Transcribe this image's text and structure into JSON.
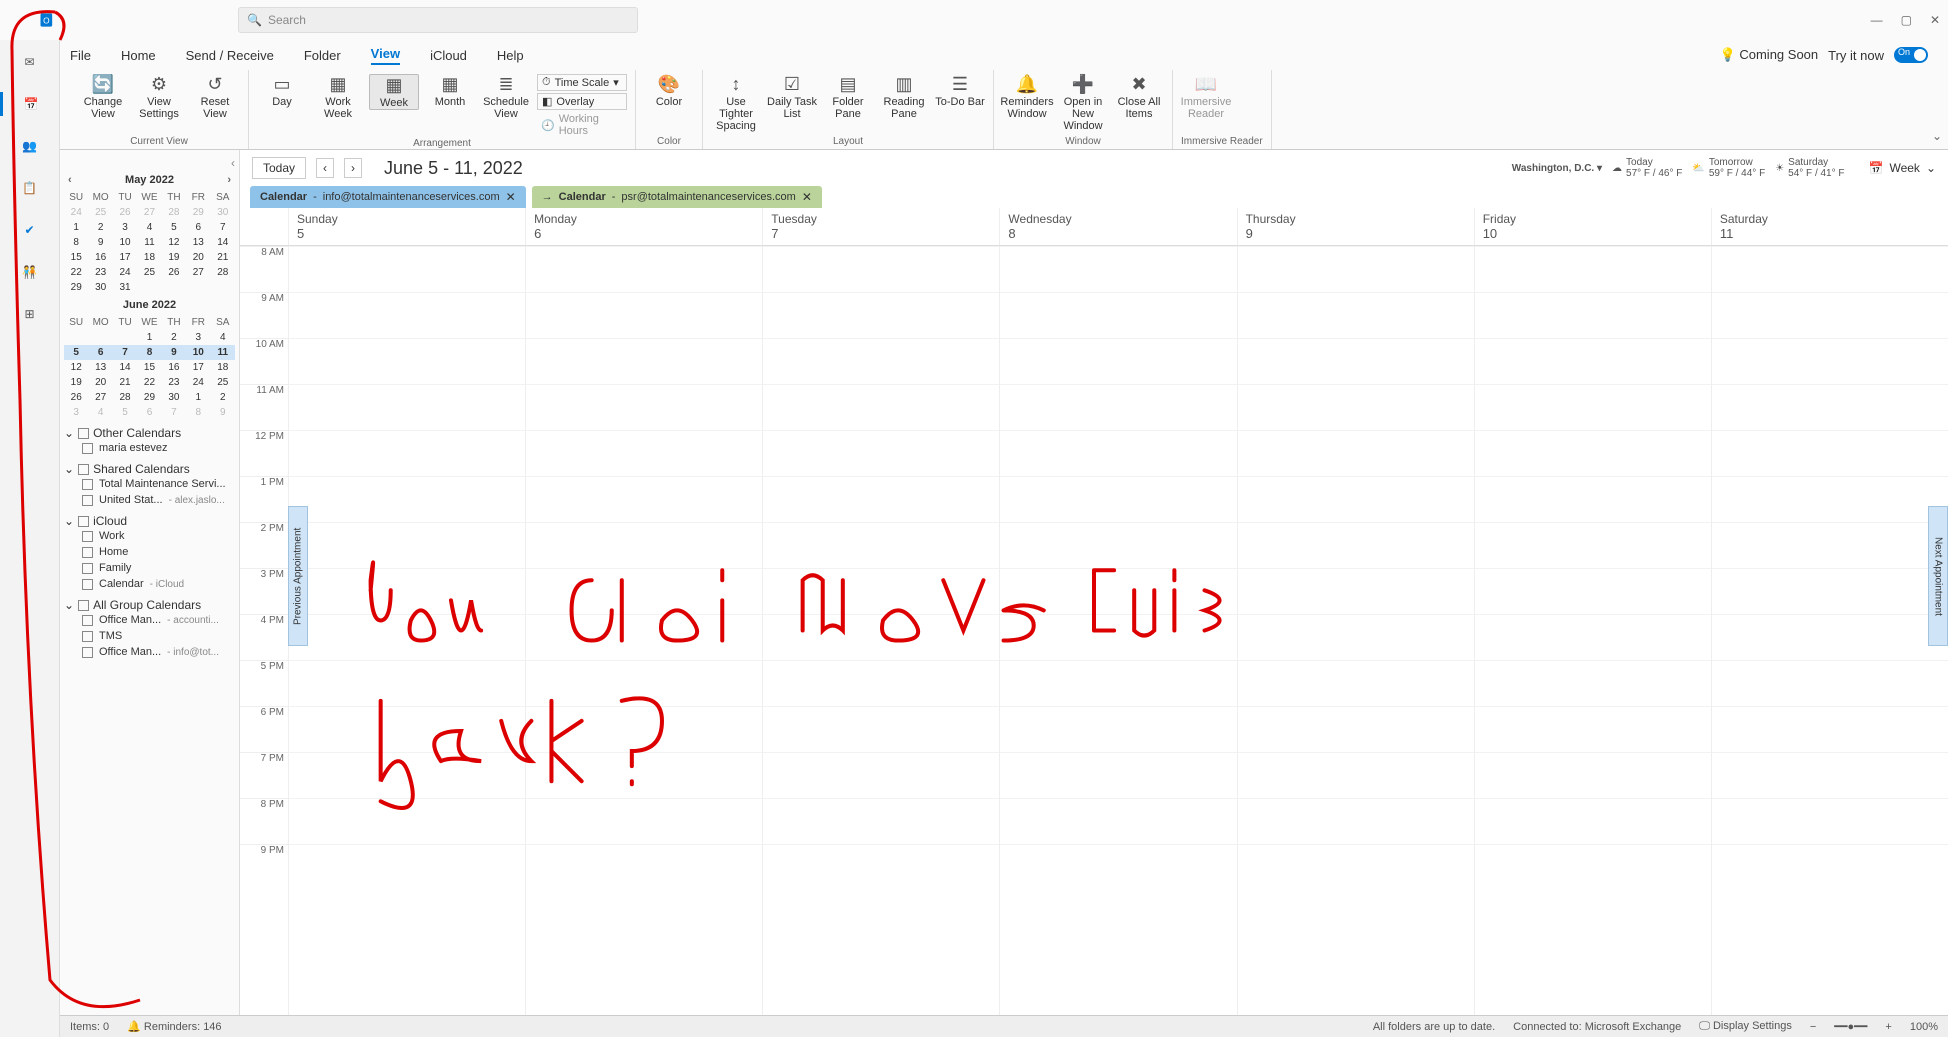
{
  "titlebar": {
    "search_placeholder": "Search"
  },
  "menutabs": {
    "items": [
      "File",
      "Home",
      "Send / Receive",
      "Folder",
      "View",
      "iCloud",
      "Help"
    ],
    "coming_soon": "Coming Soon",
    "try_it": "Try it now",
    "toggle": "On"
  },
  "ribbon": {
    "groups": {
      "current_view": {
        "label": "Current View",
        "btns": [
          {
            "label": "Change View"
          },
          {
            "label": "View Settings"
          },
          {
            "label": "Reset View"
          }
        ]
      },
      "arrangement": {
        "label": "Arrangement",
        "btns": [
          {
            "label": "Day"
          },
          {
            "label": "Work Week"
          },
          {
            "label": "Week",
            "sel": true
          },
          {
            "label": "Month"
          },
          {
            "label": "Schedule View"
          }
        ],
        "side": [
          {
            "label": "Time Scale"
          },
          {
            "label": "Overlay"
          },
          {
            "label": "Working Hours",
            "dim": true
          }
        ]
      },
      "color": {
        "label": "Color",
        "btn": "Color"
      },
      "layout": {
        "label": "Layout",
        "btns": [
          {
            "label": "Use Tighter Spacing"
          },
          {
            "label": "Daily Task List"
          },
          {
            "label": "Folder Pane"
          },
          {
            "label": "Reading Pane"
          },
          {
            "label": "To-Do Bar"
          }
        ]
      },
      "window": {
        "label": "Window",
        "btns": [
          {
            "label": "Reminders Window"
          },
          {
            "label": "Open in New Window"
          },
          {
            "label": "Close All Items"
          }
        ]
      },
      "immersive": {
        "label": "Immersive Reader",
        "btn": "Immersive Reader"
      }
    }
  },
  "mini_cal": {
    "may": {
      "title": "May 2022",
      "dows": [
        "SU",
        "MO",
        "TU",
        "WE",
        "TH",
        "FR",
        "SA"
      ],
      "rows": [
        [
          "24",
          "25",
          "26",
          "27",
          "28",
          "29",
          "30"
        ],
        [
          "1",
          "2",
          "3",
          "4",
          "5",
          "6",
          "7"
        ],
        [
          "8",
          "9",
          "10",
          "11",
          "12",
          "13",
          "14"
        ],
        [
          "15",
          "16",
          "17",
          "18",
          "19",
          "20",
          "21"
        ],
        [
          "22",
          "23",
          "24",
          "25",
          "26",
          "27",
          "28"
        ],
        [
          "29",
          "30",
          "31",
          "",
          "",
          "",
          ""
        ]
      ],
      "dim_row0": true
    },
    "june": {
      "title": "June 2022",
      "dows": [
        "SU",
        "MO",
        "TU",
        "WE",
        "TH",
        "FR",
        "SA"
      ],
      "rows": [
        [
          "",
          "",
          "",
          "1",
          "2",
          "3",
          "4"
        ],
        [
          "5",
          "6",
          "7",
          "8",
          "9",
          "10",
          "11"
        ],
        [
          "12",
          "13",
          "14",
          "15",
          "16",
          "17",
          "18"
        ],
        [
          "19",
          "20",
          "21",
          "22",
          "23",
          "24",
          "25"
        ],
        [
          "26",
          "27",
          "28",
          "29",
          "30",
          "1",
          "2"
        ],
        [
          "3",
          "4",
          "5",
          "6",
          "7",
          "8",
          "9"
        ]
      ],
      "hl_row": 1,
      "dim_row5": true
    }
  },
  "cal_groups": [
    {
      "name": "Other Calendars",
      "items": [
        {
          "label": "maria estevez"
        }
      ]
    },
    {
      "name": "Shared Calendars",
      "items": [
        {
          "label": "Total Maintenance Servi..."
        },
        {
          "label": "United Stat...",
          "src": "- alex.jaslo..."
        }
      ]
    },
    {
      "name": "iCloud",
      "items": [
        {
          "label": "Work"
        },
        {
          "label": "Home"
        },
        {
          "label": "Family"
        },
        {
          "label": "Calendar",
          "src": "- iCloud"
        }
      ]
    },
    {
      "name": "All Group Calendars",
      "items": [
        {
          "label": "Office Man...",
          "src": "- accounti..."
        },
        {
          "label": "TMS"
        },
        {
          "label": "Office Man...",
          "src": "- info@tot..."
        }
      ]
    }
  ],
  "caltoolbar": {
    "today": "Today",
    "range": "June 5 - 11, 2022",
    "weather": {
      "loc": "Washington,  D.C.",
      "days": [
        {
          "label": "Today",
          "temp": "57° F / 46° F"
        },
        {
          "label": "Tomorrow",
          "temp": "59° F / 44° F"
        },
        {
          "label": "Saturday",
          "temp": "54° F / 41° F"
        }
      ]
    },
    "viewsel": "Week"
  },
  "caltabs": [
    {
      "name": "Calendar",
      "email": "info@totalmaintenanceservices.com",
      "color": "blue"
    },
    {
      "name": "Calendar",
      "email": "psr@totalmaintenanceservices.com",
      "color": "green"
    }
  ],
  "days": [
    {
      "name": "Sunday",
      "num": "5"
    },
    {
      "name": "Monday",
      "num": "6"
    },
    {
      "name": "Tuesday",
      "num": "7"
    },
    {
      "name": "Wednesday",
      "num": "8"
    },
    {
      "name": "Thursday",
      "num": "9"
    },
    {
      "name": "Friday",
      "num": "10"
    },
    {
      "name": "Saturday",
      "num": "11"
    }
  ],
  "hours": [
    "8 AM",
    "9 AM",
    "10 AM",
    "11 AM",
    "12 PM",
    "1 PM",
    "2 PM",
    "3 PM",
    "4 PM",
    "5 PM",
    "6 PM",
    "7 PM",
    "8 PM",
    "9 PM"
  ],
  "nav_handles": {
    "prev": "Previous Appointment",
    "next": "Next Appointment"
  },
  "statusbar": {
    "items": "Items: 0",
    "reminders": "Reminders: 146",
    "folders": "All folders are up to date.",
    "connected": "Connected to: Microsoft Exchange",
    "display": "Display Settings",
    "zoom": "100%"
  }
}
